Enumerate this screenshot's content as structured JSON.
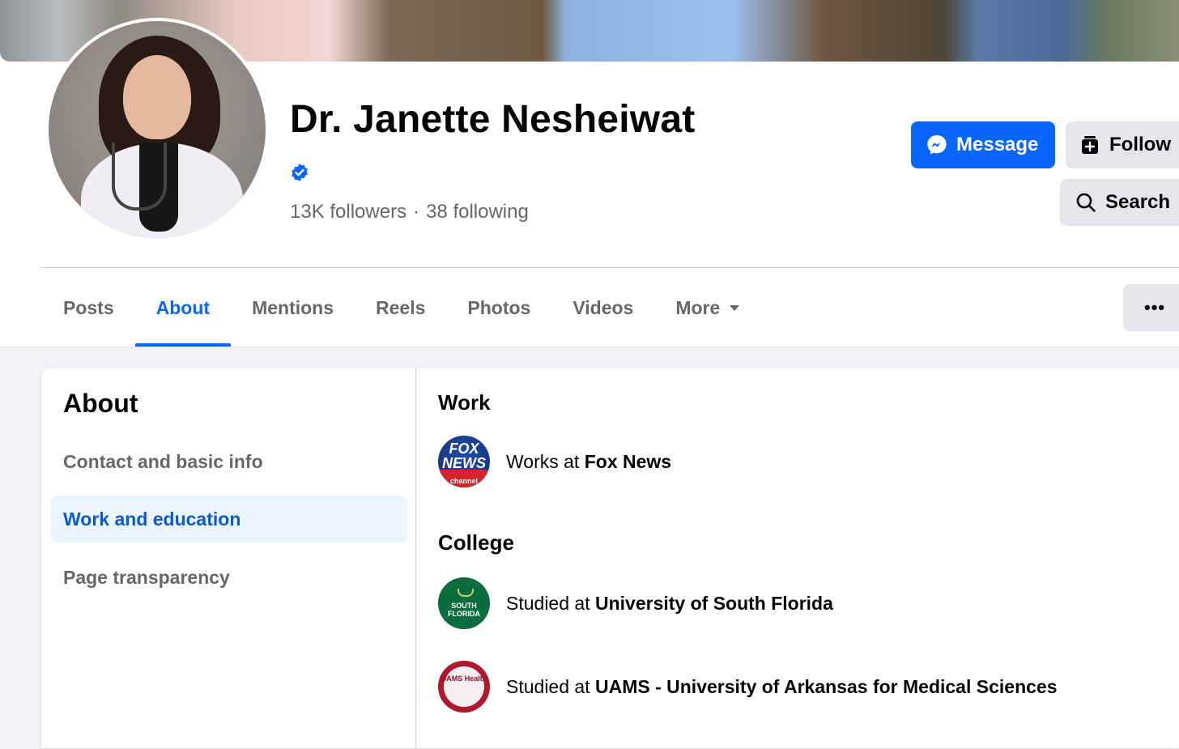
{
  "profile": {
    "name": "Dr. Janette Nesheiwat",
    "followers": "13K followers",
    "separator": "·",
    "following": "38 following"
  },
  "actions": {
    "message_label": "Message",
    "follow_label": "Follow",
    "search_label": "Search",
    "more_options_label": "•••"
  },
  "tabs": [
    "Posts",
    "About",
    "Mentions",
    "Reels",
    "Photos",
    "Videos",
    "More"
  ],
  "active_tab": "About",
  "about": {
    "title": "About",
    "items": [
      "Contact and basic info",
      "Work and education",
      "Page transparency"
    ],
    "active_item": "Work and education"
  },
  "work": {
    "title": "Work",
    "prefix": "Works at",
    "employer": "Fox News",
    "logo_text_1": "FOX",
    "logo_text_2": "NEWS",
    "logo_text_3": "channel"
  },
  "college": {
    "title": "College",
    "entries": [
      {
        "prefix": "Studied at",
        "school": "University of South Florida",
        "logo_text": "SOUTH FLORIDA"
      },
      {
        "prefix": "Studied at",
        "school": "UAMS - University of Arkansas for Medical Sciences",
        "logo_text": "UAMS Health"
      }
    ]
  },
  "colors": {
    "primary": "#0866ff",
    "secondary_button": "#e4e6eb",
    "muted_text": "#65676b",
    "active_side_bg": "#ebf5ff"
  }
}
